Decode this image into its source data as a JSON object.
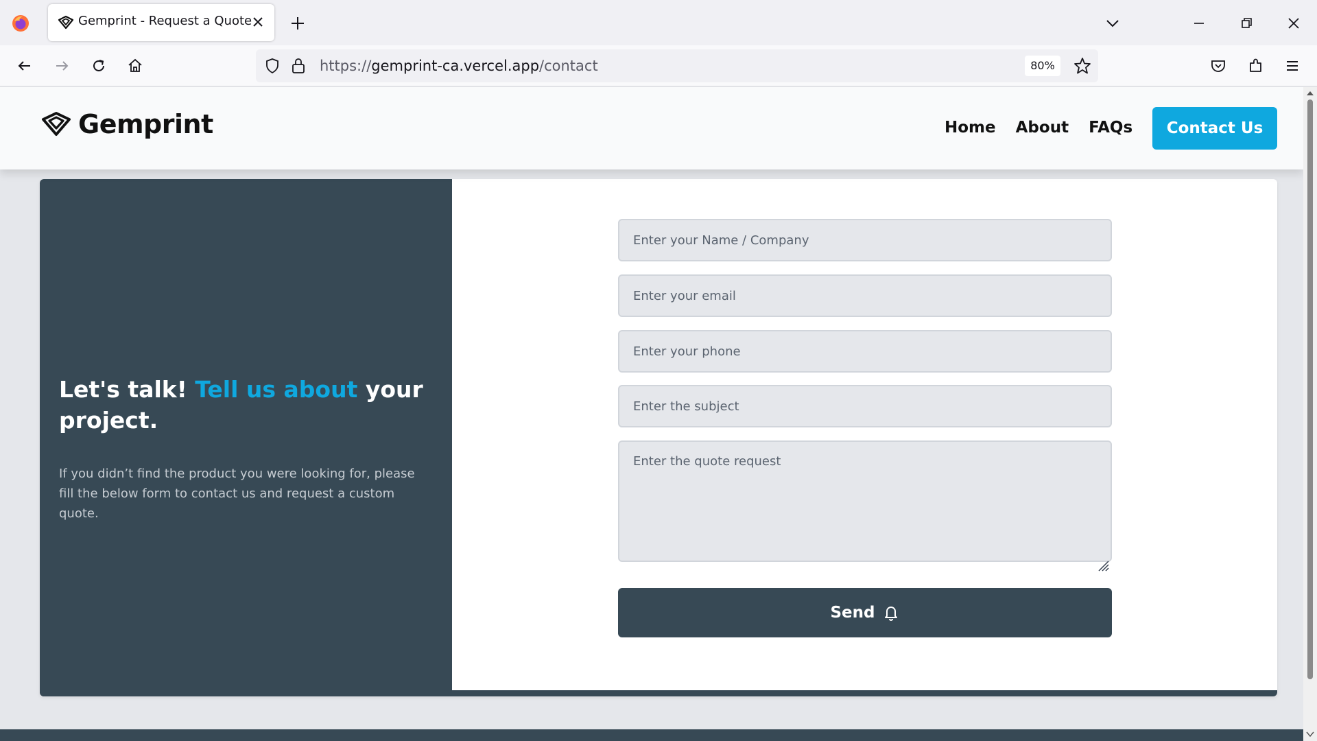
{
  "browser": {
    "tab_title": "Gemprint - Request a Quote",
    "url_host": "gemprint-ca.vercel.app",
    "url_prefix": "https://",
    "url_path": "/contact",
    "zoom": "80%"
  },
  "site": {
    "brand": "Gemprint",
    "nav": [
      "Home",
      "About",
      "FAQs"
    ],
    "cta_label": "Contact Us",
    "accent_color": "#0fa8df",
    "dark_color": "#374955"
  },
  "hero": {
    "headline_1": "Let's talk! ",
    "headline_accent": "Tell us about",
    "headline_2": " your project.",
    "subtext": "If you didn’t find the product you were looking for, please fill the below form to contact us and request a custom quote."
  },
  "form": {
    "name_placeholder": "Enter your Name / Company",
    "email_placeholder": "Enter your email",
    "phone_placeholder": "Enter your phone",
    "subject_placeholder": "Enter the subject",
    "quote_placeholder": "Enter the quote request",
    "send_label": "Send"
  }
}
